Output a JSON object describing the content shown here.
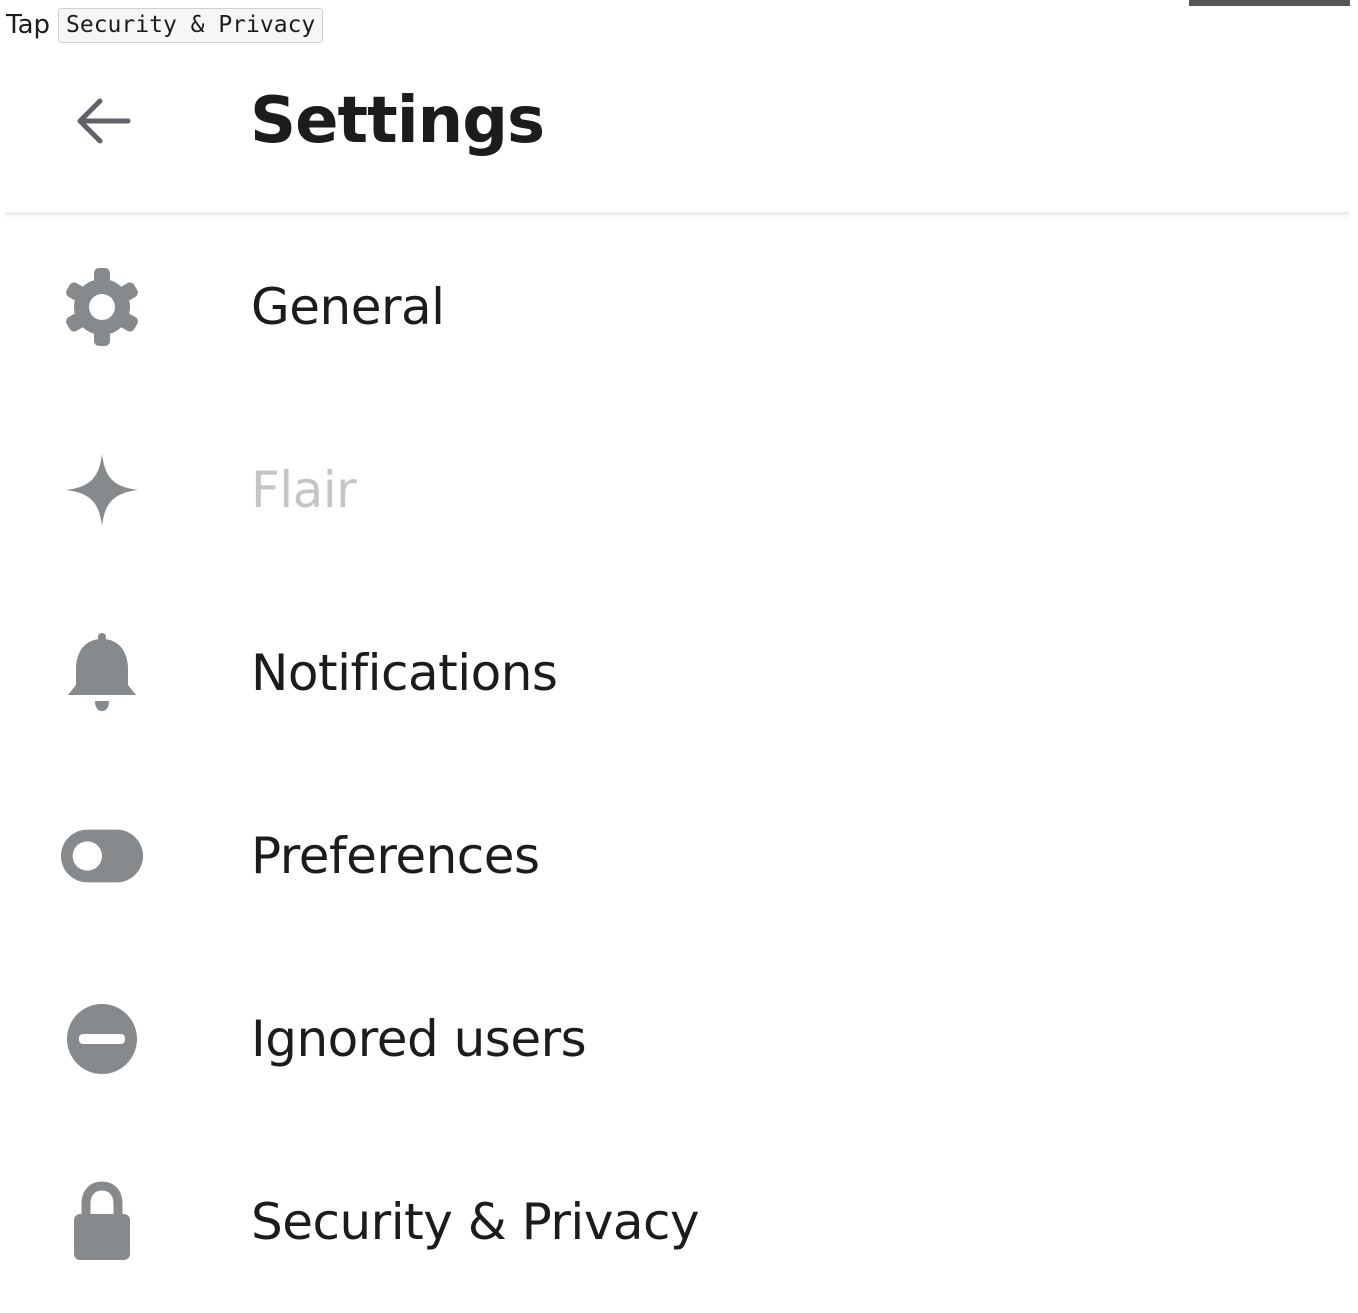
{
  "instruction": {
    "verb": "Tap",
    "target": "Security & Privacy"
  },
  "header": {
    "title": "Settings",
    "back_icon": "arrow-left-icon"
  },
  "menu": {
    "items": [
      {
        "label": "General",
        "icon": "gear-icon",
        "enabled": true
      },
      {
        "label": "Flair",
        "icon": "sparkle-icon",
        "enabled": false
      },
      {
        "label": "Notifications",
        "icon": "bell-icon",
        "enabled": true
      },
      {
        "label": "Preferences",
        "icon": "toggle-icon",
        "enabled": true
      },
      {
        "label": "Ignored users",
        "icon": "block-icon",
        "enabled": true
      },
      {
        "label": "Security & Privacy",
        "icon": "lock-icon",
        "enabled": true
      }
    ]
  },
  "colors": {
    "icon_gray": "#878a8c",
    "text": "#1c1c1c",
    "disabled_text": "#c3c5c8",
    "divider": "#e9ebee"
  }
}
